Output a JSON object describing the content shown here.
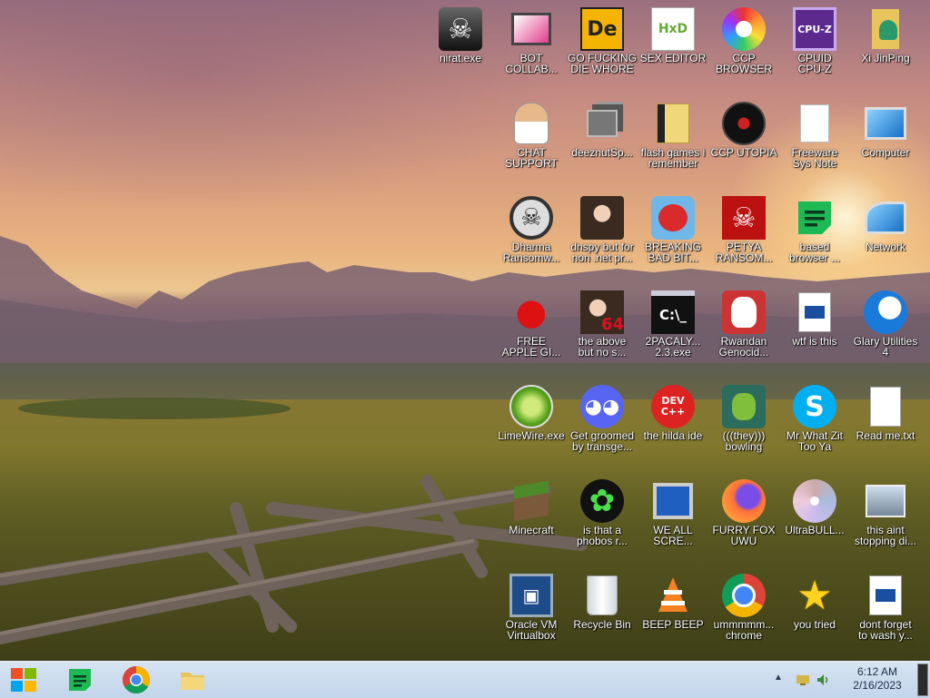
{
  "desktop": {
    "icons": [
      {
        "label": "nirat.exe",
        "icon": "skull-icon"
      },
      {
        "label": "BOT\nCOLLAB...",
        "icon": "monitor-pink-icon"
      },
      {
        "label": "GO FUCKING\nDIE WHORE",
        "icon": "de-logo-icon",
        "glyph": "De"
      },
      {
        "label": "SEX EDITOR",
        "icon": "hxd-icon",
        "glyph": "HxD"
      },
      {
        "label": "CCP\nBROWSER",
        "icon": "chromium-rainbow-icon"
      },
      {
        "label": "CPUID\nCPU-Z",
        "icon": "cpuz-icon",
        "glyph": "CPU-Z"
      },
      {
        "label": "Xi JinPing",
        "icon": "user-folder-icon"
      },
      {
        "label": "CHAT\nSUPPORT",
        "icon": "support-person-icon"
      },
      {
        "label": "deeznutSp...",
        "icon": "stacked-windows-icon"
      },
      {
        "label": "flash games i\nremember",
        "icon": "folder-documents-icon"
      },
      {
        "label": "CCP UTOPIA",
        "icon": "black-disc-icon"
      },
      {
        "label": "Freeware\nSys Note",
        "icon": "blank-document-icon"
      },
      {
        "label": "Computer",
        "icon": "computer-icon"
      },
      {
        "label": "Dharma\nRansomw...",
        "icon": "helmet-skull-icon"
      },
      {
        "label": "dnspy but for\nnon .net pr...",
        "icon": "portrait-woman-icon"
      },
      {
        "label": "BREAKING\nBAD BIT...",
        "icon": "angry-bird-icon"
      },
      {
        "label": "PETYA\nRANSOM...",
        "icon": "red-skull-icon"
      },
      {
        "label": "based\nbrowser ...",
        "icon": "green-notes-icon"
      },
      {
        "label": "Network",
        "icon": "network-globe-icon"
      },
      {
        "label": "FREE\nAPPLE GI...",
        "icon": "red-apple-icon"
      },
      {
        "label": "the above\nbut no s...",
        "icon": "portrait-64-icon",
        "glyph": "64"
      },
      {
        "label": "2PACALY...\n2.3.exe",
        "icon": "terminal-icon",
        "glyph": "C:\\_"
      },
      {
        "label": "Rwandan\nGenocid...",
        "icon": "meme-face-icon"
      },
      {
        "label": "wtf is this",
        "icon": "dll-file-icon"
      },
      {
        "label": "Glary Utilities\n4",
        "icon": "glary-icon"
      },
      {
        "label": "LimeWire.exe",
        "icon": "limewire-icon"
      },
      {
        "label": "Get groomed\nby transge...",
        "icon": "discord-icon"
      },
      {
        "label": "the hilda ide",
        "icon": "devcpp-icon",
        "glyph": "DEV C++"
      },
      {
        "label": "(((they)))\nbowling",
        "icon": "grinch-icon"
      },
      {
        "label": "Mr What Zit\nToo Ya",
        "icon": "skype-icon",
        "glyph": "S"
      },
      {
        "label": "Read me.txt",
        "icon": "text-file-icon"
      },
      {
        "label": "Minecraft",
        "icon": "grass-block-icon"
      },
      {
        "label": "is that a\nphobos r...",
        "icon": "icq-flower-icon"
      },
      {
        "label": "WE ALL\nSCRE...",
        "icon": "old-computer-icon"
      },
      {
        "label": "FURRY FOX\nUWU",
        "icon": "firefox-icon"
      },
      {
        "label": "UltraBULL...",
        "icon": "disc-icon"
      },
      {
        "label": "this aint\nstopping di...",
        "icon": "computer-setup-icon"
      },
      {
        "label": "Oracle VM\nVirtualbox",
        "icon": "virtualbox-icon"
      },
      {
        "label": "Recycle Bin",
        "icon": "recycle-bin-icon"
      },
      {
        "label": "BEEP BEEP",
        "icon": "vlc-cone-icon"
      },
      {
        "label": "ummmmm...\nchrome",
        "icon": "chrome-icon"
      },
      {
        "label": "you tried",
        "icon": "gold-star-icon"
      },
      {
        "label": "dont forget\nto wash y...",
        "icon": "dll-file-icon"
      }
    ]
  },
  "taskbar": {
    "clock_time": "6:12 AM",
    "clock_date": "2/16/2023",
    "pinned": [
      {
        "name": "start-button",
        "icon": "windows-logo-icon"
      },
      {
        "name": "notes-app",
        "icon": "green-notes-icon"
      },
      {
        "name": "chrome-app",
        "icon": "chrome-icon"
      },
      {
        "name": "explorer-app",
        "icon": "folder-icon"
      }
    ]
  },
  "colors": {
    "taskbar": "#c9d9ec",
    "label_text": "#ffffff"
  }
}
